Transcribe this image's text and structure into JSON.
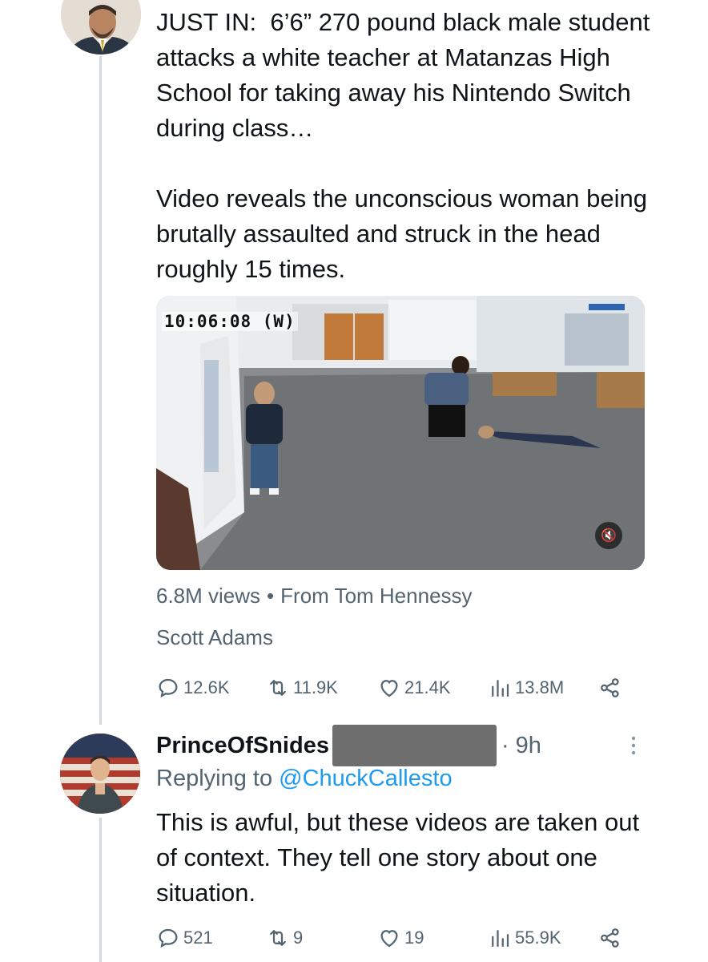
{
  "tweet": {
    "text": "JUST IN:  6’6” 270 pound black male student attacks a white teacher at Matanzas High School for taking away his Nintendo Switch during class…\n\nVideo reveals the unconscious woman being brutally assaulted and struck in the head roughly 15 times.",
    "media": {
      "video_timestamp": "10:06:08 (W)",
      "mute_icon": "speaker-muted-icon"
    },
    "views": "6.8M views",
    "separator": "•",
    "from_source": "From Tom Hennessy",
    "quoted_author": "Scott Adams",
    "actions": {
      "replies": "12.6K",
      "retweets": "11.9K",
      "likes": "21.4K",
      "views": "13.8M"
    }
  },
  "reply": {
    "display_name": "PrinceOfSnides",
    "time": "· 9h",
    "replying_to_prefix": "Replying to",
    "replying_to_handle": "@ChuckCallesto",
    "text": "This is awful, but these videos are taken out of context. They tell one story about one situation.",
    "actions": {
      "replies": "521",
      "retweets": "9",
      "likes": "19",
      "views": "55.9K"
    }
  },
  "colors": {
    "text": "#0f1419",
    "secondary": "#536471",
    "link": "#1d9bf0",
    "thread_line": "#cfd9de"
  },
  "icons": [
    "comment-icon",
    "retweet-icon",
    "heart-icon",
    "analytics-icon",
    "share-icon",
    "more-icon"
  ]
}
